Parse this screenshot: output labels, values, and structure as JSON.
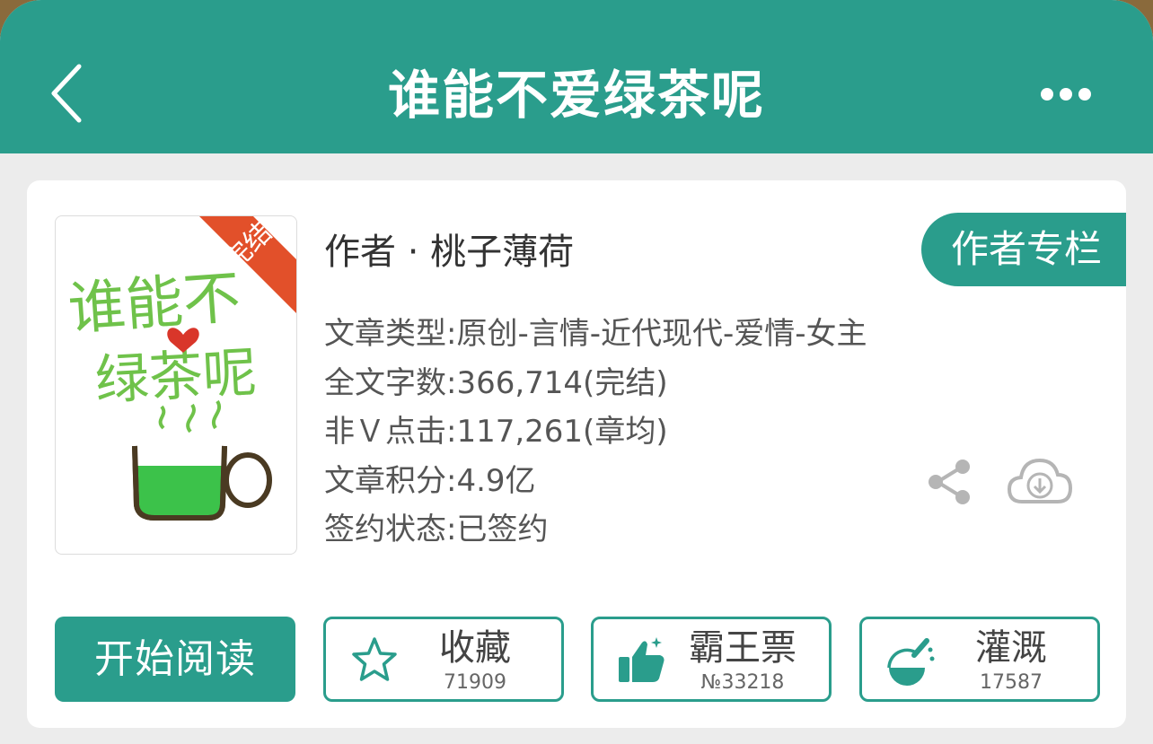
{
  "nav": {
    "title": "谁能不爱绿茶呢",
    "back_icon": "chevron-left-icon",
    "more_icon": "more-dots-icon"
  },
  "book": {
    "cover": {
      "badge": "完结",
      "title_art": "谁能不爱绿茶呢"
    },
    "author": "作者 · 桃子薄荷",
    "author_column_label": "作者专栏",
    "meta": [
      "文章类型:原创-言情-近代现代-爱情-女主",
      "全文字数:366,714(完结)",
      "非Ｖ点击:117,261(章均)",
      "文章积分:4.9亿",
      "签约状态:已签约"
    ]
  },
  "actions": {
    "read_label": "开始阅读",
    "favorite": {
      "label": "收藏",
      "count": "71909",
      "icon": "star-icon"
    },
    "bawang": {
      "label": "霸王票",
      "count": "№33218",
      "icon": "thumbs-up-icon"
    },
    "irrigate": {
      "label": "灌溉",
      "count": "17587",
      "icon": "watering-flask-icon"
    }
  },
  "colors": {
    "accent": "#2a9d8c",
    "badge": "#e2502a",
    "text": "#333333",
    "muted_icon": "#b5b5b5"
  }
}
